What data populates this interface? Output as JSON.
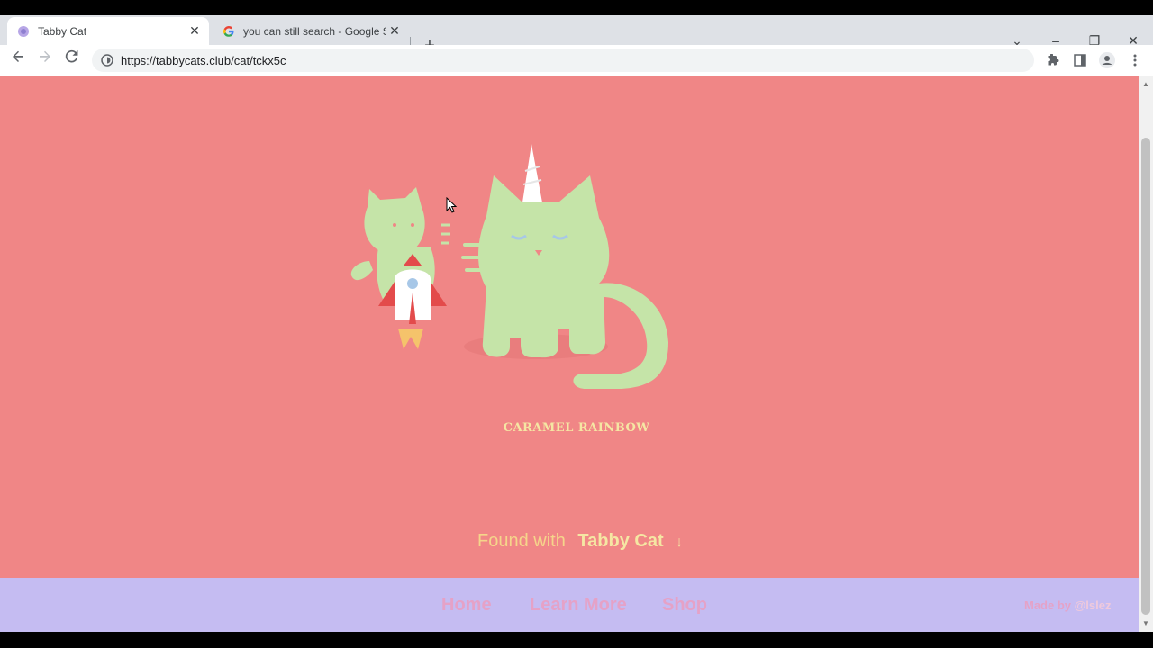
{
  "browser": {
    "tabs": [
      {
        "title": "Tabby Cat",
        "favicon": "tabby-cat-logo",
        "active": true
      },
      {
        "title": "you can still search - Google Sea",
        "favicon": "google-logo",
        "active": false
      }
    ],
    "new_tab_symbol": "+",
    "url": "https://tabbycats.club/cat/tckx5c",
    "window_controls": {
      "dropdown": "⌄",
      "minimize": "–",
      "restore": "❐",
      "close": "✕"
    }
  },
  "page": {
    "cat_name": "CARAMEL RAINBOW",
    "found_with": "Found with",
    "brand": "Tabby Cat",
    "found_arrow": "↓",
    "footer": {
      "links": [
        "Home",
        "Learn More",
        "Shop"
      ],
      "credit_prefix": "Made by ",
      "credit_handle": "@lslez"
    },
    "colors": {
      "background": "#f08686",
      "cat": "#c5e4a8",
      "footer": "#c5bcf2",
      "text_accent": "#f5e6a3"
    }
  }
}
